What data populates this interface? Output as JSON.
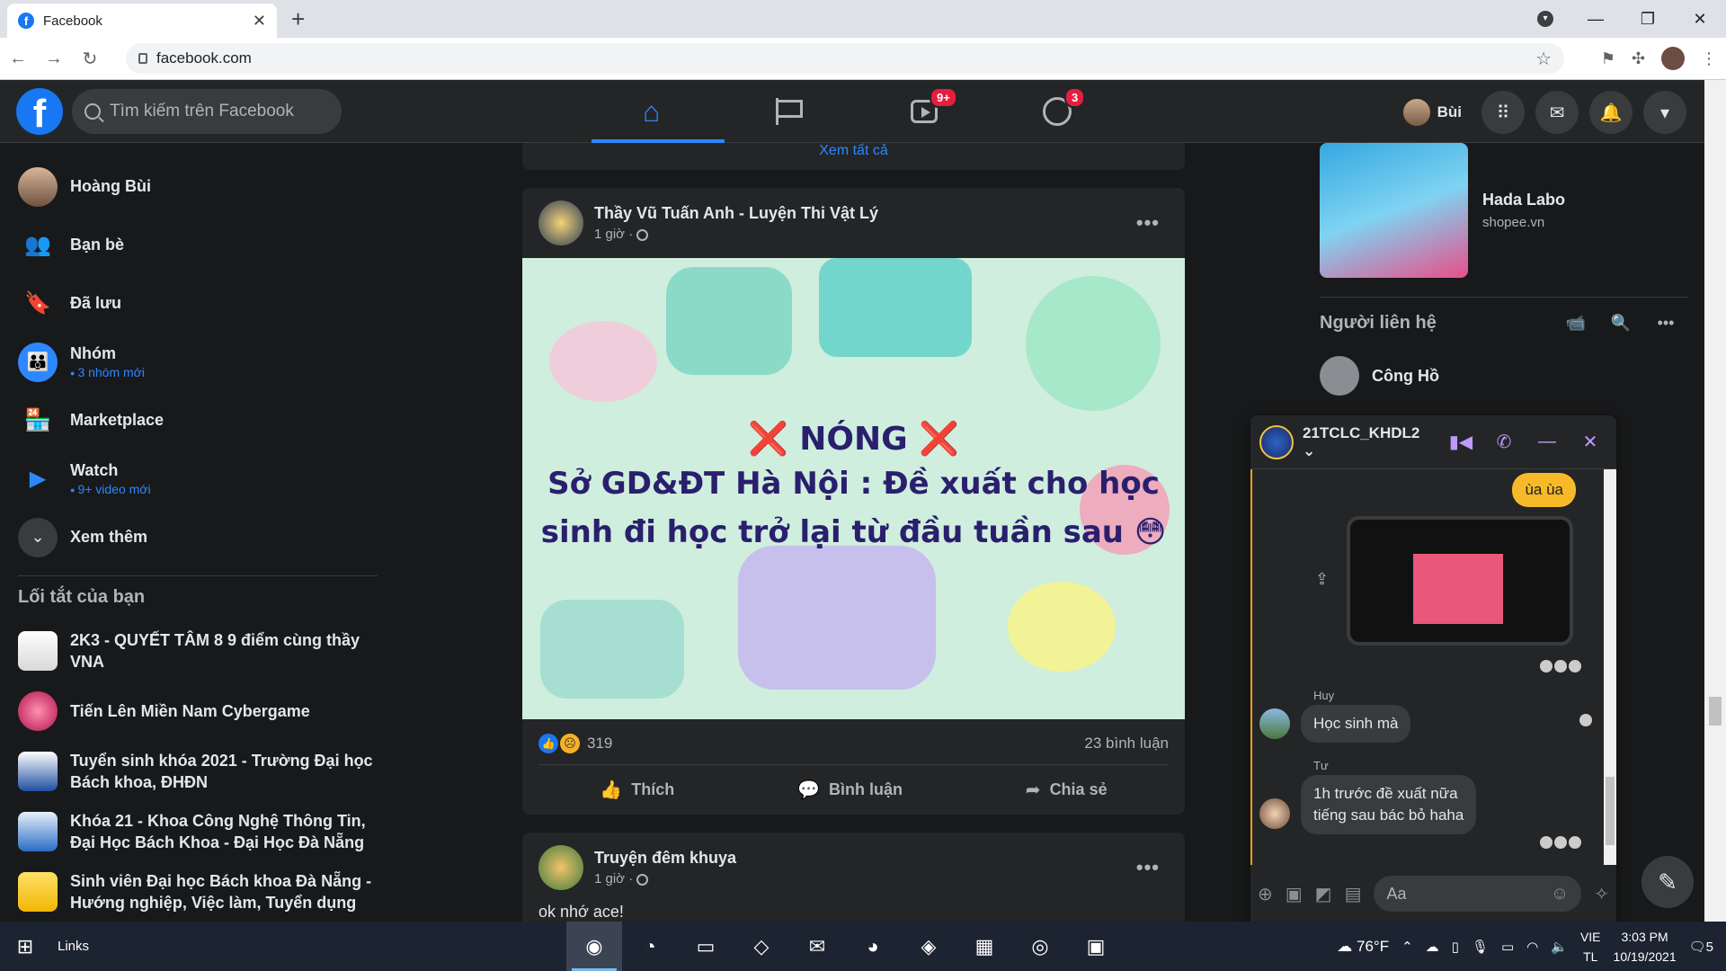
{
  "browser": {
    "tab_title": "Facebook",
    "url": "facebook.com",
    "new_tab": "+"
  },
  "header": {
    "search_placeholder": "Tìm kiếm trên Facebook",
    "watch_badge": "9+",
    "groups_badge": "3",
    "profile_name": "Bùi"
  },
  "sidebar": {
    "items": [
      {
        "label": "Hoàng Bùi",
        "sub": ""
      },
      {
        "label": "Bạn bè",
        "sub": ""
      },
      {
        "label": "Đã lưu",
        "sub": ""
      },
      {
        "label": "Nhóm",
        "sub": "3 nhóm mới"
      },
      {
        "label": "Marketplace",
        "sub": ""
      },
      {
        "label": "Watch",
        "sub": "9+ video mới"
      },
      {
        "label": "Xem thêm",
        "sub": ""
      }
    ],
    "shortcuts_title": "Lối tắt của bạn",
    "shortcuts": [
      "2K3 - QUYẾT TÂM 8 9 điểm cùng thầy VNA",
      "Tiến Lên Miền Nam Cybergame",
      "Tuyển sinh khóa 2021 - Trường Đại học Bách khoa, ĐHĐN",
      "Khóa 21 - Khoa Công Nghệ Thông Tin, Đại Học Bách Khoa - Đại Học Đà Nẵng",
      "Sinh viên Đại học Bách khoa Đà Nẵng - Hướng nghiệp, Việc làm, Tuyển dụng"
    ]
  },
  "feed": {
    "prev_card_link": "Xem tất cả",
    "post1": {
      "author": "Thầy Vũ Tuấn Anh - Luyện Thi Vật Lý",
      "time": "1 giờ ·",
      "image_line1": "❌ NÓNG ❌",
      "image_line2a": "Sở GD&ĐT Hà Nội : Đề xuất cho học",
      "image_line2b": "sinh đi học trở lại từ đầu tuần sau 😳",
      "reactions_count": "319",
      "comments": "23 bình luận",
      "like": "Thích",
      "comment": "Bình luận",
      "share": "Chia sẻ"
    },
    "post2": {
      "author": "Truyện đêm khuya",
      "time": "1 giờ ·",
      "text": "ok nhớ ace!"
    }
  },
  "right": {
    "ad_title": "Hada Labo",
    "ad_domain": "shopee.vn",
    "contacts_title": "Người liên hệ",
    "contact_name": "Công Hồ"
  },
  "chat": {
    "title": "21TCLC_KHDL2 ⌄",
    "msg_me": "ùa ùa",
    "sender1": "Huy",
    "msg1": "Học sinh mà",
    "sender2": "Tư",
    "msg2_line1": "1h trước đề xuất nữa",
    "msg2_line2": "tiếng sau bác bỏ haha",
    "input_placeholder": "Aa"
  },
  "taskbar": {
    "links": "Links",
    "temp": "76°F",
    "lang1": "VIE",
    "lang2": "TL",
    "time": "3:03 PM",
    "date": "10/19/2021",
    "notif_count": "5"
  },
  "colors": {
    "fb_blue": "#1877f2",
    "accent_blue": "#2d88ff",
    "dark_bg": "#18191a",
    "card_bg": "#242526",
    "chat_me": "#f7b928"
  }
}
